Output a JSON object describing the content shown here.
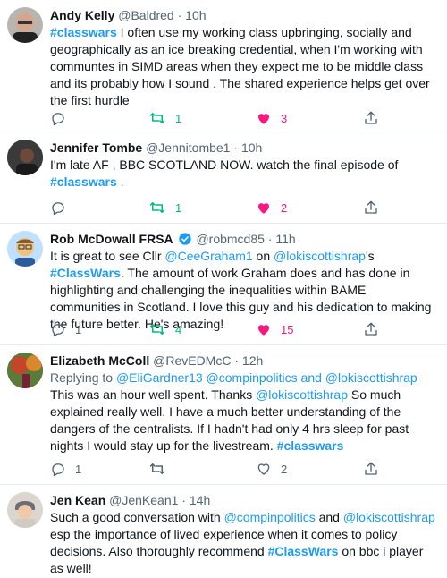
{
  "tweets": [
    {
      "name": "Andy Kelly",
      "handle": "@Baldred",
      "time": "10h",
      "text_parts": [
        {
          "t": "#classwars",
          "k": "hashtag"
        },
        {
          "t": " I often use my working class upbringing, socially and geographically as an ice breaking credential, when I'm working with communtes in SIMD areas when they expect me to be middle class and its probably how I sound . The shared experience helps get over the first hurdle",
          "k": "plain"
        }
      ],
      "replies": "",
      "retweets": "1",
      "likes": "3"
    },
    {
      "name": "Jennifer Tombe",
      "handle": "@Jennitombe1",
      "time": "10h",
      "text_parts": [
        {
          "t": "I'm late AF , BBC SCOTLAND NOW. watch the final episode of ",
          "k": "plain"
        },
        {
          "t": "#classwars",
          "k": "hashtag"
        },
        {
          "t": " .",
          "k": "plain"
        }
      ],
      "replies": "",
      "retweets": "1",
      "likes": "2"
    },
    {
      "name": "Rob McDowall FRSA",
      "handle": "@robmcd85",
      "time": "11h",
      "verified": true,
      "text_parts": [
        {
          "t": "It is great to see Cllr ",
          "k": "plain"
        },
        {
          "t": "@CeeGraham1",
          "k": "link"
        },
        {
          "t": " on ",
          "k": "plain"
        },
        {
          "t": "@lokiscottishrap",
          "k": "link"
        },
        {
          "t": "'s ",
          "k": "plain"
        },
        {
          "t": "#ClassWars",
          "k": "hashtag"
        },
        {
          "t": ". The amount of work Graham does and has done in highlighting and challenging the inequalities within BAME communities in Scotland. I love this guy and his dedication to making the future better. He's amazing!",
          "k": "plain"
        }
      ],
      "replies": "1",
      "retweets": "4",
      "likes": "15"
    },
    {
      "name": "Elizabeth McColl",
      "handle": "@RevEDMcC",
      "time": "12h",
      "replying_prefix": "Replying to ",
      "replying_to": "@EliGardner13 @compinpolitics and @lokiscottishrap",
      "text_parts": [
        {
          "t": "This was an hour well spent. Thanks ",
          "k": "plain"
        },
        {
          "t": "@lokiscottishrap",
          "k": "link"
        },
        {
          "t": " So much explained really well. I have a much better understanding of the dangers of the centralists. If I hadn't had only 4 hrs sleep for past nights I would stay up for the livestream. ",
          "k": "plain"
        },
        {
          "t": "#classwars",
          "k": "hashtag"
        }
      ],
      "replies": "1",
      "retweets": "",
      "likes": "2"
    },
    {
      "name": "Jen Kean",
      "handle": "@JenKean1",
      "time": "14h",
      "text_parts": [
        {
          "t": "Such a good conversation with ",
          "k": "plain"
        },
        {
          "t": "@compinpolitics",
          "k": "link"
        },
        {
          "t": " and ",
          "k": "plain"
        },
        {
          "t": "@lokiscottishrap",
          "k": "link"
        },
        {
          "t": " esp the importance of lived experience when it comes to policy decisions. Also thoroughly recommend ",
          "k": "plain"
        },
        {
          "t": "#ClassWars",
          "k": "hashtag"
        },
        {
          "t": " on bbc i player as well!",
          "k": "plain"
        }
      ]
    }
  ],
  "icons": {
    "reply": "reply-icon",
    "retweet": "retweet-icon",
    "like": "heart-filled-icon",
    "like_outline": "heart-outline-icon",
    "share": "share-icon",
    "verified": "verified-badge-icon"
  },
  "colors": {
    "link": "#1d9bf0",
    "retweet": "#00ba7c",
    "like": "#f91880",
    "muted": "#536471",
    "divider": "#e6ecf0"
  }
}
